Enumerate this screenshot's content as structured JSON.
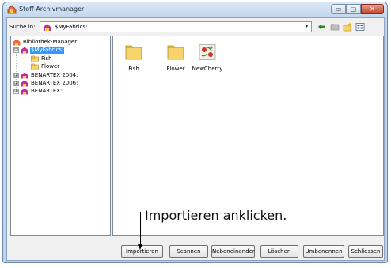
{
  "window": {
    "title": "Stoff-Archivmanager",
    "app_icon": "stoff-archiv-icon",
    "controls": {
      "minimize": "▭",
      "maximize": "▢",
      "close": "✕"
    }
  },
  "search": {
    "label": "Suche in:",
    "value": "$MyFabrics:",
    "value_icon": "library-icon",
    "dropdown_glyph": "▾"
  },
  "toolbar": {
    "icons": [
      "back-arrow-icon",
      "up-folder-icon",
      "new-folder-icon",
      "view-menu-icon"
    ]
  },
  "tree": {
    "root": "Bibliothek-Manager",
    "items": [
      {
        "label": "$MyFabrics:",
        "selected": true,
        "expander": "⊟"
      },
      {
        "label": "Fish"
      },
      {
        "label": "Flower"
      },
      {
        "label": "BENARTEX 2004:",
        "expander": "⊞"
      },
      {
        "label": "BENARTEX 2006:",
        "expander": "⊞"
      },
      {
        "label": "BENARTEX:",
        "expander": "⊞"
      }
    ]
  },
  "files": [
    {
      "name": "Fish",
      "icon": "folder-icon"
    },
    {
      "name": "Flower",
      "icon": "folder-icon"
    },
    {
      "name": "NewCherry",
      "icon": "fabric-thumbnail"
    }
  ],
  "annotation": {
    "text": "Importieren anklicken."
  },
  "buttons": {
    "import": "Importieren",
    "scan": "Scannen",
    "side_by_side": "Nebeneinander",
    "delete": "Löschen",
    "rename": "Umbenennen",
    "close": "Schliessen"
  },
  "colors": {
    "selection": "#3399ff",
    "folder": "#f7d36b",
    "title_bar": "#c2d6ee"
  }
}
